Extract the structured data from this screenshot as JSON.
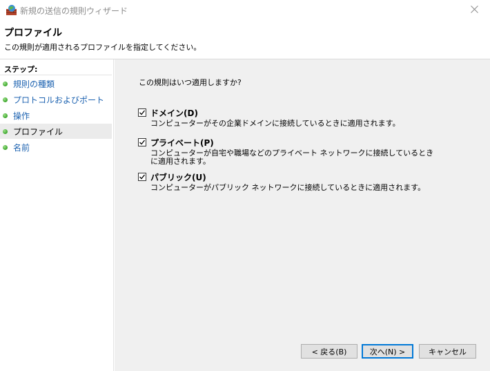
{
  "window": {
    "title": "新規の送信の規則ウィザード"
  },
  "header": {
    "title": "プロファイル",
    "description": "この規則が適用されるプロファイルを指定してください。"
  },
  "steps": {
    "heading": "ステップ:",
    "items": [
      {
        "label": "規則の種類"
      },
      {
        "label": "プロトコルおよびポート"
      },
      {
        "label": "操作"
      },
      {
        "label": "プロファイル",
        "active": true
      },
      {
        "label": "名前"
      }
    ]
  },
  "content": {
    "question": "この規則はいつ適用しますか?",
    "options": [
      {
        "label": "ドメイン(D)",
        "checked": true,
        "description": "コンピューターがその企業ドメインに接続しているときに適用されます。"
      },
      {
        "label": "プライベート(P)",
        "checked": true,
        "description": "コンピューターが自宅や職場などのプライベート ネットワークに接続しているときに適用されます。"
      },
      {
        "label": "パブリック(U)",
        "checked": true,
        "description": "コンピューターがパブリック ネットワークに接続しているときに適用されます。"
      }
    ]
  },
  "buttons": {
    "back": "< 戻る(B)",
    "next": "次へ(N) >",
    "cancel": "キャンセル"
  }
}
